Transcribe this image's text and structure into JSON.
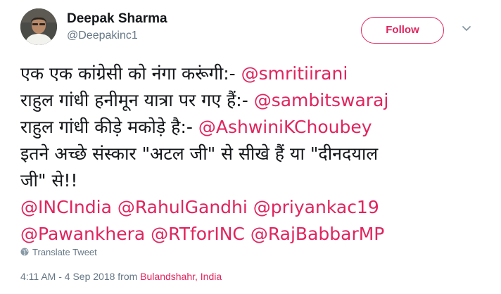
{
  "user": {
    "display_name": "Deepak Sharma",
    "handle": "@Deepakinc1"
  },
  "follow_button": {
    "label": "Follow"
  },
  "tweet": {
    "line1": {
      "text": "एक एक कांग्रेसी को नंगा करूंगी:- ",
      "mention": "@smritiirani"
    },
    "line2": {
      "text": "राहुल गांधी हनीमून यात्रा पर गए हैं:- ",
      "mention": "@sambitswaraj"
    },
    "line3": {
      "text": "राहुल गांधी कीड़े मकोड़े है:- ",
      "mention": "@AshwiniKChoubey"
    },
    "line4": {
      "text": "इतने अच्छे संस्कार \"अटल जी\" से सीखे हैं या \"दीनदयाल"
    },
    "line5": {
      "text": "जी\" से!!"
    },
    "line6": {
      "m1": "@INCIndia",
      "m2": "@RahulGandhi",
      "m3": "@priyankac19"
    },
    "line7": {
      "m1": "@Pawankhera",
      "m2": "@RTforINC",
      "m3": "@RajBabbarMP"
    }
  },
  "translate": {
    "label": "Translate Tweet",
    "icon": "globe-icon"
  },
  "meta": {
    "time": "4:11 AM - 4 Sep 2018",
    "from_label": " from ",
    "location": "Bulandshahr, India"
  },
  "colors": {
    "accent": "#e0245e",
    "secondary_text": "#657786",
    "primary_text": "#14171a"
  }
}
